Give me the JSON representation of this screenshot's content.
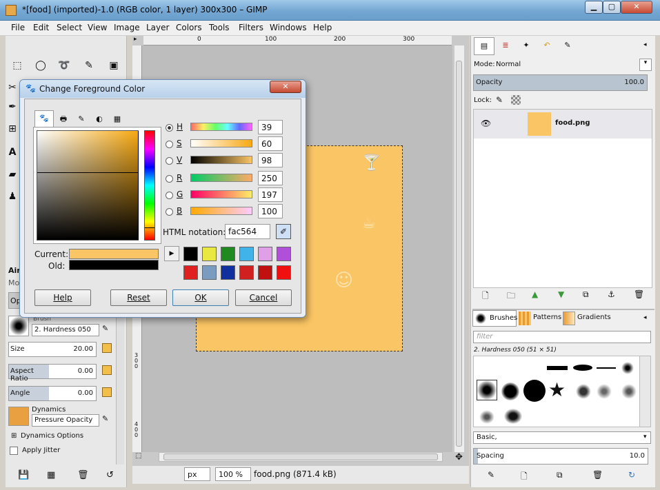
{
  "window": {
    "title": "*[food] (imported)-1.0 (RGB color, 1 layer) 300x300 – GIMP",
    "min": "▁",
    "max": "▢",
    "close": "✕"
  },
  "menu": [
    "File",
    "Edit",
    "Select",
    "View",
    "Image",
    "Layer",
    "Colors",
    "Tools",
    "Filters",
    "Windows",
    "Help"
  ],
  "ruler": {
    "t0": "0",
    "t100": "100",
    "t200": "200",
    "t300": "300",
    "l300": "3\n0\n0",
    "l400": "4\n0\n0"
  },
  "tool_options": {
    "title": "Airl",
    "mode_label": "Mo",
    "opacity_label": "Op",
    "brush_label": "Brush",
    "brush_value": "2. Hardness 050",
    "size_label": "Size",
    "size_value": "20.00",
    "aspect_label": "Aspect Ratio",
    "aspect_value": "0.00",
    "angle_label": "Angle",
    "angle_value": "0.00",
    "dynamics_label": "Dynamics",
    "dynamics_value": "Pressure Opacity",
    "dynamics_options": "Dynamics Options",
    "apply_jitter": "Apply Jitter"
  },
  "status": {
    "unit": "px",
    "zoom": "100 %",
    "file": "food.png (871.4 kB)"
  },
  "layers": {
    "mode_label": "Mode:",
    "mode_value": "Normal",
    "opacity_label": "Opacity",
    "opacity_value": "100.0",
    "lock_label": "Lock:",
    "layer_name": "food.png"
  },
  "brushes": {
    "tab_brushes": "Brushes",
    "tab_patterns": "Patterns",
    "tab_gradients": "Gradients",
    "filter_placeholder": "filter",
    "current": "2. Hardness 050 (51 × 51)",
    "preset": "Basic,",
    "spacing_label": "Spacing",
    "spacing_value": "10.0"
  },
  "dialog": {
    "title": "Change Foreground Color",
    "close": "✕",
    "channels": [
      {
        "label": "H",
        "value": "39"
      },
      {
        "label": "S",
        "value": "60"
      },
      {
        "label": "V",
        "value": "98"
      },
      {
        "label": "R",
        "value": "250"
      },
      {
        "label": "G",
        "value": "197"
      },
      {
        "label": "B",
        "value": "100"
      }
    ],
    "html_label": "HTML notation:",
    "html_value": "fac564",
    "current_label": "Current:",
    "old_label": "Old:",
    "current_color": "#fac564",
    "old_color": "#000000",
    "history": [
      "#000000",
      "#e8e840",
      "#1f8a1f",
      "#40b4e8",
      "#e0a0e8",
      "#b050d8",
      "#e02020",
      "#7a9cc0",
      "#1030a0",
      "#d02020",
      "#c01010",
      "#f01010"
    ],
    "buttons": {
      "help": "Help",
      "reset": "Reset",
      "ok": "OK",
      "cancel": "Cancel"
    }
  },
  "colors": {
    "accent": "#fac564",
    "titlebar": "#74a7d2"
  }
}
